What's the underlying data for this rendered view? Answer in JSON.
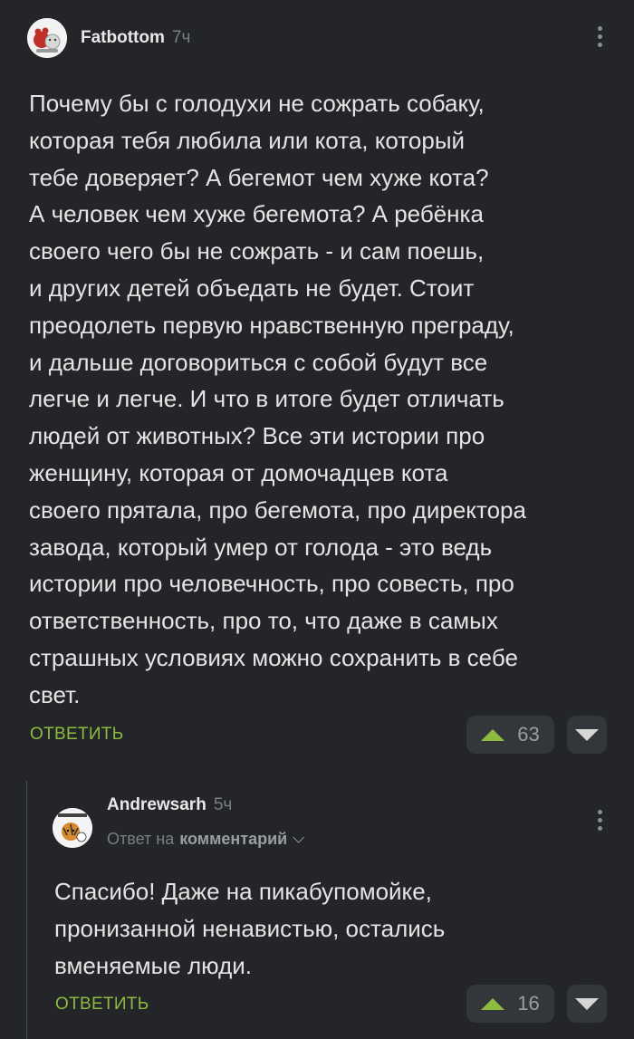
{
  "comment": {
    "author": "Fatbottom",
    "time": "7ч",
    "text_lines": [
      "Почему бы с голодухи не сожрать собаку,",
      "которая тебя любила или кота, который",
      "тебе доверяет? А бегемот чем хуже кота?",
      "А человек чем хуже бегемота? А ребёнка",
      "своего чего бы не сожрать - и сам поешь,",
      "и других детей объедать не будет. Стоит",
      "преодолеть первую нравственную преграду,",
      "и дальше договориться с собой будут все",
      "легче и легче. И что в итоге будет отличать",
      "людей от животных? Все эти истории про",
      "женщину, которая от домочадцев кота",
      "своего прятала, про бегемота, про директора",
      "завода, который умер от голода - это ведь",
      "истории про человечность, про совесть, про",
      "ответственность, про то, что даже в самых",
      "страшных условиях можно сохранить в себе",
      "свет."
    ],
    "reply_label": "ОТВЕТИТЬ",
    "rating": "63"
  },
  "reply": {
    "author": "Andrewsarh",
    "time": "5ч",
    "reply_to_prefix": "Ответ на",
    "reply_to_target": "комментарий",
    "text_lines": [
      "Спасибо! Даже на пикабупомойке,",
      "пронизанной ненавистью, остались",
      "вменяемые люди."
    ],
    "reply_label": "ОТВЕТИТЬ",
    "rating": "16"
  },
  "colors": {
    "background": "#232528",
    "accent_green": "#8dbb3f",
    "vote_button_bg": "#33363b"
  },
  "icons": {
    "menu": "kebab-vertical-icon",
    "upvote": "triangle-up-icon",
    "downvote": "triangle-down-icon",
    "expand": "chevron-down-icon"
  }
}
